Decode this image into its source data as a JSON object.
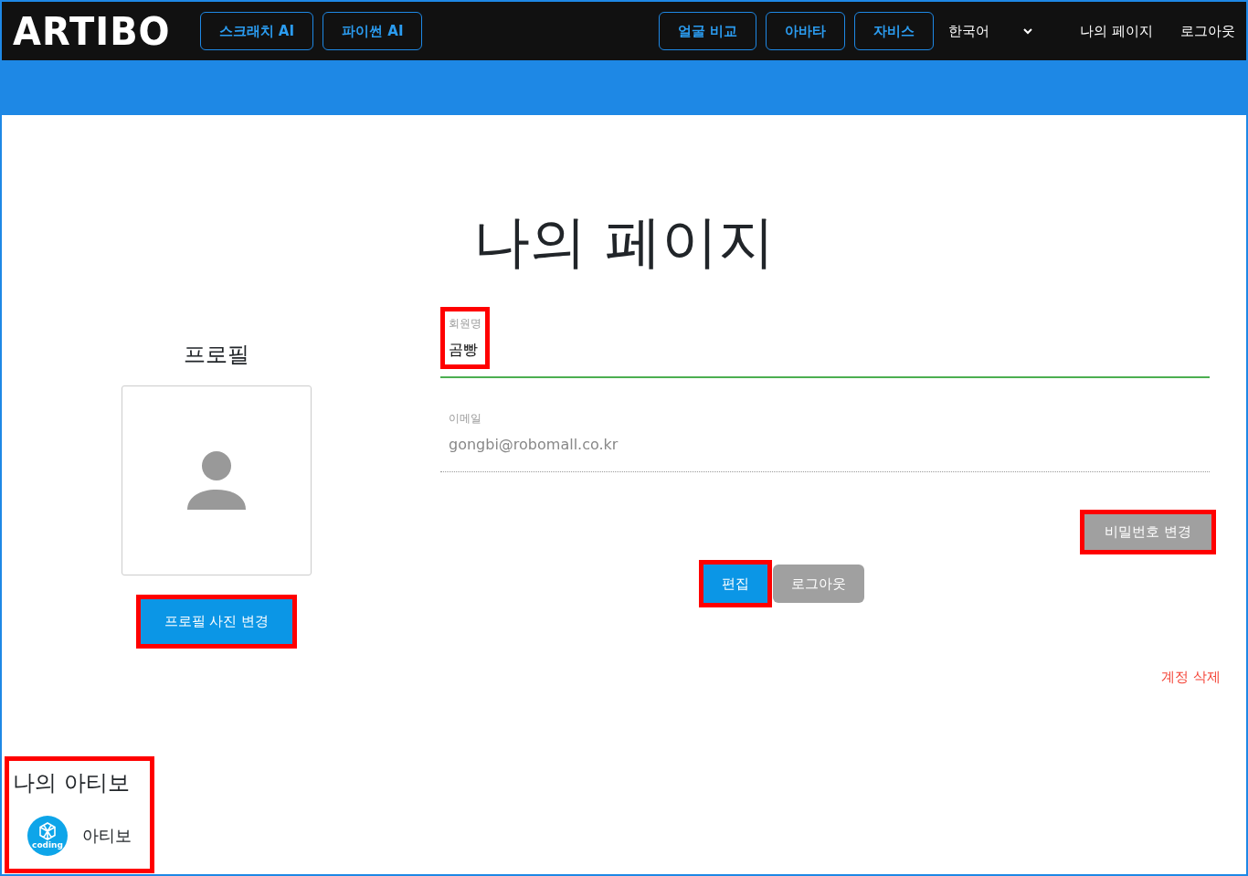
{
  "navbar": {
    "logo": "ARTIBO",
    "left_buttons": [
      {
        "label": "스크래치 AI"
      },
      {
        "label": "파이썬 AI"
      }
    ],
    "right_buttons": [
      {
        "label": "얼굴 비교"
      },
      {
        "label": "아바타"
      },
      {
        "label": "자비스"
      }
    ],
    "language": {
      "value": "한국어"
    },
    "links": [
      {
        "label": "나의 페이지"
      },
      {
        "label": "로그아웃"
      }
    ]
  },
  "page_title": "나의 페이지",
  "profile": {
    "heading": "프로필",
    "button": {
      "label": "프로필 사진 변경",
      "highlighted": true
    }
  },
  "fields": [
    {
      "label": "회원명",
      "value": "곰빵",
      "focused": true,
      "highlighted": true
    },
    {
      "label": "이메일",
      "value": "gongbi@robomall.co.kr",
      "focused": false,
      "highlighted": false
    }
  ],
  "password_button": {
    "label": "비밀번호 변경",
    "highlighted": true
  },
  "actions": [
    {
      "label": "편집",
      "kind": "primary",
      "highlighted": true
    },
    {
      "label": "로그아웃",
      "kind": "secondary",
      "highlighted": false
    }
  ],
  "delete_link": "계정 삭제",
  "my_artibo": {
    "heading": "나의 아티보",
    "highlighted": true,
    "items": [
      {
        "logo_text": "coding",
        "name": "아티보"
      }
    ]
  }
}
